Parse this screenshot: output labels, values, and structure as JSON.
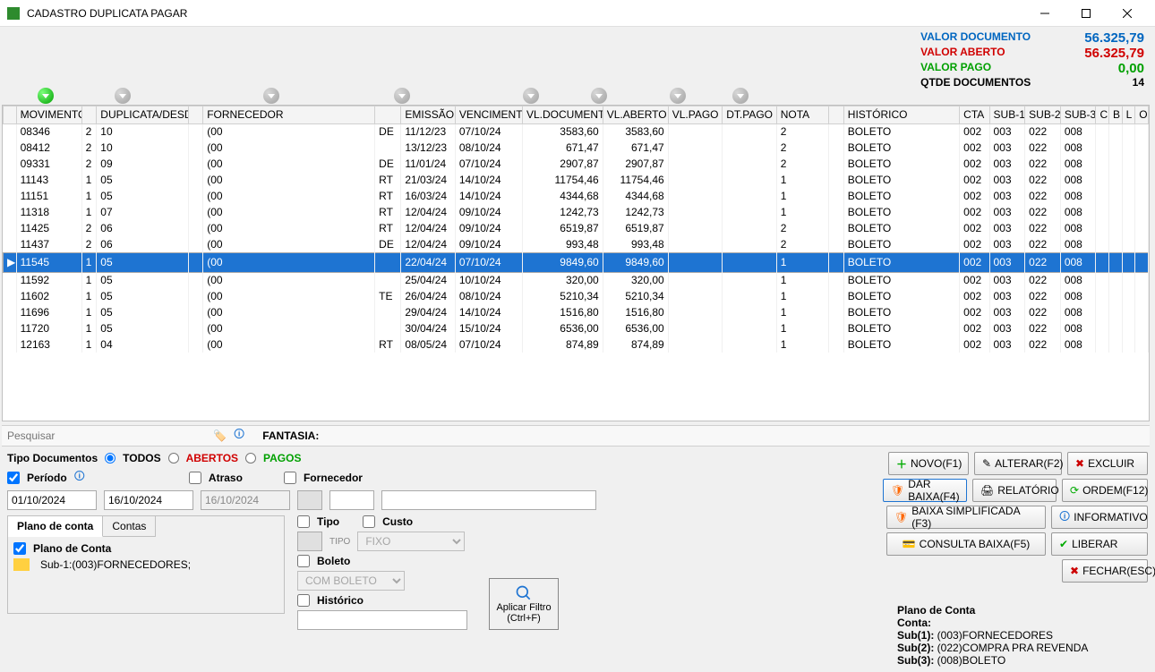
{
  "window": {
    "title": "CADASTRO DUPLICATA PAGAR"
  },
  "summary": {
    "doc_label": "VALOR  DOCUMENTO",
    "doc_val": "56.325,79",
    "aberto_label": "VALOR ABERTO",
    "aberto_val": "56.325,79",
    "pago_label": "VALOR PAGO",
    "pago_val": "0,00",
    "qtde_label": "QTDE DOCUMENTOS",
    "qtde_val": "14"
  },
  "columns": [
    "MOVIMENTO",
    "DUPLICATA/DESD",
    "",
    "FORNECEDOR",
    "",
    "EMISSÃO",
    "VENCIMENTO",
    "VL.DOCUMENTO",
    "VL.ABERTO",
    "VL.PAGO",
    "DT.PAGO",
    "NOTA",
    "",
    "HISTÓRICO",
    "CTA",
    "SUB-1",
    "SUB-2",
    "SUB-3",
    "C",
    "B",
    "L",
    "O"
  ],
  "rows": [
    {
      "mov": "08346",
      "dup": "2",
      "desd": "10",
      "forn": "(00",
      "pre": "DE",
      "emi": "11/12/23",
      "venc": "07/10/24",
      "vdoc": "3583,60",
      "vab": "3583,60",
      "nota": "2",
      "hist": "BOLETO",
      "cta": "002",
      "s1": "003",
      "s2": "022",
      "s3": "008"
    },
    {
      "mov": "08412",
      "dup": "2",
      "desd": "10",
      "forn": "(00",
      "pre": "",
      "emi": "13/12/23",
      "venc": "08/10/24",
      "vdoc": "671,47",
      "vab": "671,47",
      "nota": "2",
      "hist": "BOLETO",
      "cta": "002",
      "s1": "003",
      "s2": "022",
      "s3": "008"
    },
    {
      "mov": "09331",
      "dup": "2",
      "desd": "09",
      "forn": "(00",
      "pre": "DE",
      "emi": "11/01/24",
      "venc": "07/10/24",
      "vdoc": "2907,87",
      "vab": "2907,87",
      "nota": "2",
      "hist": "BOLETO",
      "cta": "002",
      "s1": "003",
      "s2": "022",
      "s3": "008"
    },
    {
      "mov": "11143",
      "dup": "1",
      "desd": "05",
      "forn": "(00",
      "pre": "RT",
      "emi": "21/03/24",
      "venc": "14/10/24",
      "vdoc": "11754,46",
      "vab": "11754,46",
      "nota": "1",
      "hist": "BOLETO",
      "cta": "002",
      "s1": "003",
      "s2": "022",
      "s3": "008"
    },
    {
      "mov": "11151",
      "dup": "1",
      "desd": "05",
      "forn": "(00",
      "pre": "RT",
      "emi": "16/03/24",
      "venc": "14/10/24",
      "vdoc": "4344,68",
      "vab": "4344,68",
      "nota": "1",
      "hist": "BOLETO",
      "cta": "002",
      "s1": "003",
      "s2": "022",
      "s3": "008"
    },
    {
      "mov": "11318",
      "dup": "1",
      "desd": "07",
      "forn": "(00",
      "pre": "RT",
      "emi": "12/04/24",
      "venc": "09/10/24",
      "vdoc": "1242,73",
      "vab": "1242,73",
      "nota": "1",
      "hist": "BOLETO",
      "cta": "002",
      "s1": "003",
      "s2": "022",
      "s3": "008"
    },
    {
      "mov": "11425",
      "dup": "2",
      "desd": "06",
      "forn": "(00",
      "pre": "RT",
      "emi": "12/04/24",
      "venc": "09/10/24",
      "vdoc": "6519,87",
      "vab": "6519,87",
      "nota": "2",
      "hist": "BOLETO",
      "cta": "002",
      "s1": "003",
      "s2": "022",
      "s3": "008"
    },
    {
      "mov": "11437",
      "dup": "2",
      "desd": "06",
      "forn": "(00",
      "pre": "DE",
      "emi": "12/04/24",
      "venc": "09/10/24",
      "vdoc": "993,48",
      "vab": "993,48",
      "nota": "2",
      "hist": "BOLETO",
      "cta": "002",
      "s1": "003",
      "s2": "022",
      "s3": "008"
    },
    {
      "mov": "11545",
      "dup": "1",
      "desd": "05",
      "forn": "(00",
      "pre": "",
      "emi": "22/04/24",
      "venc": "07/10/24",
      "vdoc": "9849,60",
      "vab": "9849,60",
      "nota": "1",
      "hist": "BOLETO",
      "cta": "002",
      "s1": "003",
      "s2": "022",
      "s3": "008",
      "sel": true
    },
    {
      "mov": "11592",
      "dup": "1",
      "desd": "05",
      "forn": "(00",
      "pre": "",
      "emi": "25/04/24",
      "venc": "10/10/24",
      "vdoc": "320,00",
      "vab": "320,00",
      "nota": "1",
      "hist": "BOLETO",
      "cta": "002",
      "s1": "003",
      "s2": "022",
      "s3": "008"
    },
    {
      "mov": "11602",
      "dup": "1",
      "desd": "05",
      "forn": "(00",
      "pre": "TE",
      "emi": "26/04/24",
      "venc": "08/10/24",
      "vdoc": "5210,34",
      "vab": "5210,34",
      "nota": "1",
      "hist": "BOLETO",
      "cta": "002",
      "s1": "003",
      "s2": "022",
      "s3": "008"
    },
    {
      "mov": "11696",
      "dup": "1",
      "desd": "05",
      "forn": "(00",
      "pre": "",
      "emi": "29/04/24",
      "venc": "14/10/24",
      "vdoc": "1516,80",
      "vab": "1516,80",
      "nota": "1",
      "hist": "BOLETO",
      "cta": "002",
      "s1": "003",
      "s2": "022",
      "s3": "008"
    },
    {
      "mov": "11720",
      "dup": "1",
      "desd": "05",
      "forn": "(00",
      "pre": "",
      "emi": "30/04/24",
      "venc": "15/10/24",
      "vdoc": "6536,00",
      "vab": "6536,00",
      "nota": "1",
      "hist": "BOLETO",
      "cta": "002",
      "s1": "003",
      "s2": "022",
      "s3": "008"
    },
    {
      "mov": "12163",
      "dup": "1",
      "desd": "04",
      "forn": "(00",
      "pre": "RT",
      "emi": "08/05/24",
      "venc": "07/10/24",
      "vdoc": "874,89",
      "vab": "874,89",
      "nota": "1",
      "hist": "BOLETO",
      "cta": "002",
      "s1": "003",
      "s2": "022",
      "s3": "008"
    }
  ],
  "search": {
    "placeholder": "Pesquisar",
    "fantasia_label": "FANTASIA:"
  },
  "filters": {
    "tipo_doc_label": "Tipo Documentos",
    "todos": "TODOS",
    "abertos": "ABERTOS",
    "pagos": "PAGOS",
    "periodo": "Período",
    "atraso": "Atraso",
    "fornecedor": "Fornecedor",
    "date_from": "01/10/2024",
    "date_to": "16/10/2024",
    "date_atraso": "16/10/2024",
    "tab1": "Plano de conta",
    "tab2": "Contas",
    "plano_chk": "Plano de Conta",
    "plano_val": "Sub-1:(003)FORNECEDORES;",
    "tipo": "Tipo",
    "tipo_lbl": "TIPO",
    "custo": "Custo",
    "custo_val": "FIXO",
    "boleto": "Boleto",
    "boleto_val": "COM BOLETO",
    "historico": "Histórico",
    "filtro_btn": "Aplicar Filtro (Ctrl+F)"
  },
  "buttons": {
    "novo": "NOVO(F1)",
    "alterar": "ALTERAR(F2)",
    "excluir": "EXCLUIR",
    "baixa": "DAR BAIXA(F4)",
    "relatorio": "RELATÓRIO",
    "ordem": "ORDEM(F12)",
    "baixa_simpl": "BAIXA SIMPLIFICADA (F3)",
    "informativo": "INFORMATIVO",
    "consulta": "CONSULTA BAIXA(F5)",
    "liberar": "LIBERAR",
    "fechar": "FECHAR(ESC)"
  },
  "plano": {
    "title": "Plano de Conta",
    "conta": "Conta:",
    "s1": "Sub(1):",
    "s1v": "(003)FORNECEDORES",
    "s2": "Sub(2):",
    "s2v": "(022)COMPRA PRA REVENDA",
    "s3": "Sub(3):",
    "s3v": "(008)BOLETO"
  }
}
